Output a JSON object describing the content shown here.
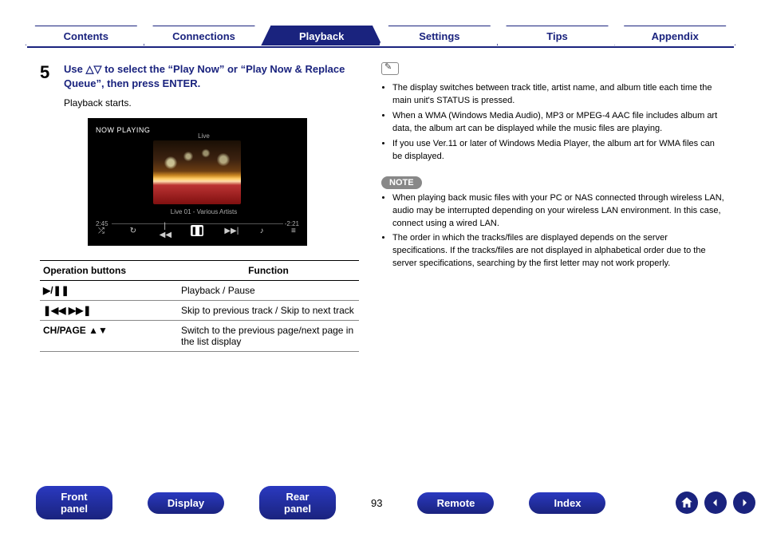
{
  "topTabs": [
    "Contents",
    "Connections",
    "Playback",
    "Settings",
    "Tips",
    "Appendix"
  ],
  "activeTab": "Playback",
  "step": {
    "num": "5",
    "title_pre": "Use ",
    "title_post": " to select the “Play Now” or “Play Now & Replace Queue”, then press ENTER.",
    "sub": "Playback starts."
  },
  "player": {
    "nowplaying": "NOW PLAYING",
    "album": "Live",
    "track": "Live 01 - Various Artists",
    "t1": "2:45",
    "t2": "-2:21"
  },
  "optable": {
    "h1": "Operation buttons",
    "h2": "Function",
    "rows": [
      {
        "op": "▶/❚❚",
        "fn": "Playback / Pause"
      },
      {
        "op": "❚◀◀ ▶▶❚",
        "fn": "Skip to previous track / Skip to next track"
      },
      {
        "op": "CH/PAGE ▲▼",
        "fn": "Switch to the previous page/next page in the list display"
      }
    ]
  },
  "tips": [
    "The display switches between track title, artist name, and album title each time the main unit's STATUS is pressed.",
    "When a WMA (Windows Media Audio), MP3 or MPEG-4 AAC file includes album art data, the album art can be displayed while the music files are playing.",
    "If you use Ver.11 or later of Windows Media Player, the album art for WMA files can be displayed."
  ],
  "noteLabel": "NOTE",
  "notes": [
    "When playing back music files with your PC or NAS connected through wireless LAN, audio may be interrupted depending on your wireless LAN environment. In this case, connect using a wired LAN.",
    "The order in which the tracks/files are displayed depends on the server specifications. If the tracks/files are not displayed in alphabetical order due to the server specifications, searching by the first letter may not work properly."
  ],
  "bottom": {
    "buttons": [
      "Front panel",
      "Display",
      "Rear panel",
      "Remote",
      "Index"
    ],
    "page": "93"
  }
}
